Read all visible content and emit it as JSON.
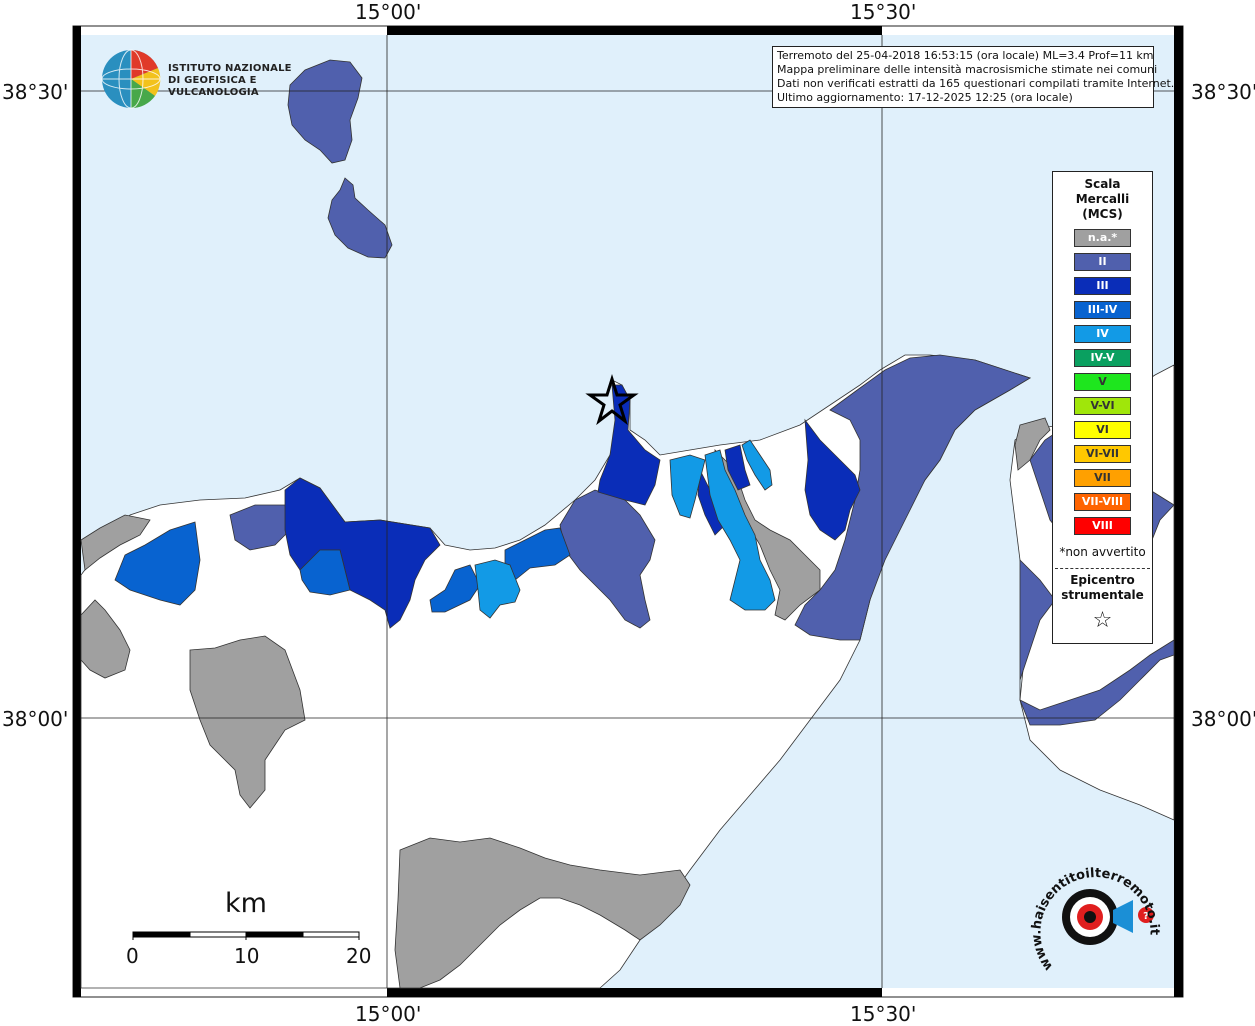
{
  "header": {
    "logo_line1": "ISTITUTO NAZIONALE",
    "logo_line2": "DI GEOFISICA E VULCANOLOGIA"
  },
  "info": {
    "line1": "Terremoto del 25-04-2018 16:53:15 (ora locale) ML=3.4 Prof=11 km",
    "line2": "Mappa preliminare delle intensità macrosismiche stimate nei comuni",
    "line3": "Dati non verificati estratti da 165 questionari compilati tramite Internet.",
    "line4": "Ultimo aggiornamento: 17-12-2025 12:25 (ora locale)"
  },
  "coords": {
    "lon_left": "15°00'",
    "lon_right": "15°30'",
    "lat_top": "38°30'",
    "lat_bottom": "38°00'"
  },
  "legend": {
    "title_line1": "Scala",
    "title_line2": "Mercalli",
    "title_line3": "(MCS)",
    "classes": [
      {
        "label": "n.a.*",
        "color": "#a0a0a0"
      },
      {
        "label": "II",
        "color": "#5060ad"
      },
      {
        "label": "III",
        "color": "#0a2db8"
      },
      {
        "label": "III-IV",
        "color": "#0863d0"
      },
      {
        "label": "IV",
        "color": "#129ae6"
      },
      {
        "label": "IV-V",
        "color": "#0aa060"
      },
      {
        "label": "V",
        "color": "#1ee61e"
      },
      {
        "label": "V-VI",
        "color": "#a0e60a"
      },
      {
        "label": "VI",
        "color": "#ffff00"
      },
      {
        "label": "VI-VII",
        "color": "#ffc800"
      },
      {
        "label": "VII",
        "color": "#ffa000"
      },
      {
        "label": "VII-VIII",
        "color": "#ff6400"
      },
      {
        "label": "VIII",
        "color": "#ff0000"
      }
    ],
    "note": "*non avvertito",
    "epicenter_line1": "Epicentro",
    "epicenter_line2": "strumentale",
    "epicenter_symbol": "☆"
  },
  "scale_bar": {
    "unit": "km",
    "ticks": [
      "0",
      "10",
      "20"
    ]
  },
  "branding": {
    "site": "www.haisentitoilterremoto.it"
  },
  "colors": {
    "sea": "#e0f0fb",
    "land": "#ffffff",
    "na": "#a0a0a0",
    "ii": "#5060ad",
    "iii": "#0a2db8",
    "iii_iv": "#0863d0",
    "iv": "#129ae6"
  }
}
